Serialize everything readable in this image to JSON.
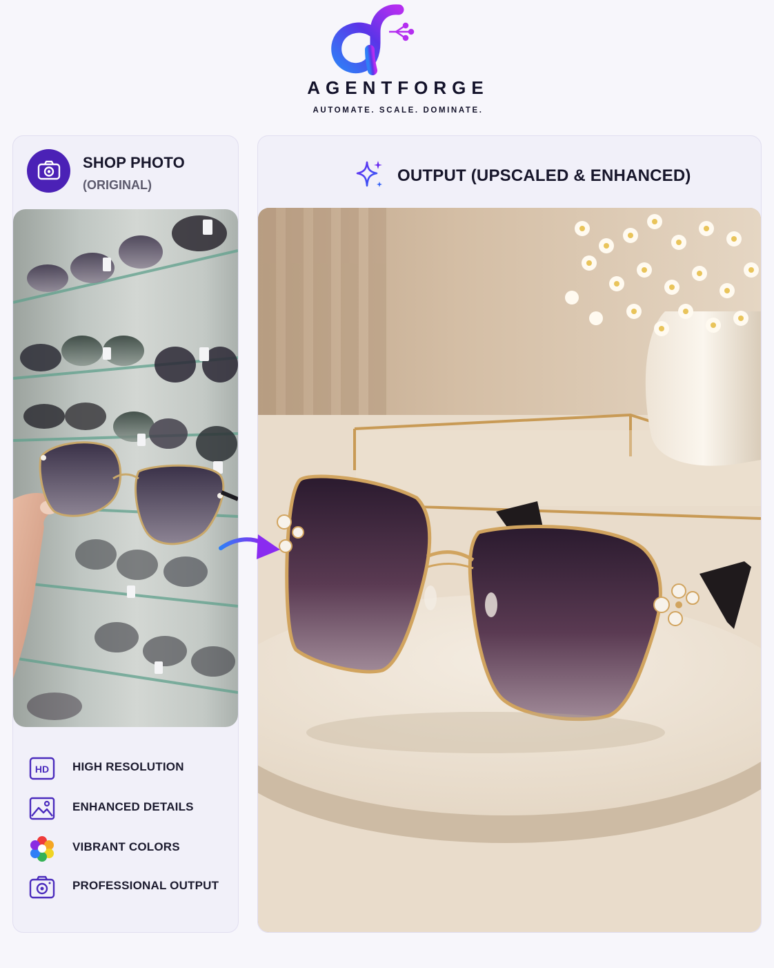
{
  "brand": {
    "name": "AGENTFORGE",
    "tagline": "AUTOMATE. SCALE. DOMINATE.",
    "logo_icon": "df-logo-mark",
    "accent_colors": [
      "#7a2bf0",
      "#2f7ff6",
      "#5b34e8"
    ]
  },
  "left_panel": {
    "title": "SHOP PHOTO",
    "subtitle": "(ORIGINAL)",
    "badge_icon": "camera-icon",
    "image_alt": "Hand holding sunglasses in front of shop display shelves"
  },
  "right_panel": {
    "title": "OUTPUT (UPSCALED & ENHANCED)",
    "title_icon": "sparkle-icon",
    "image_alt": "Sunglasses on marble stand with flowers background"
  },
  "features": [
    {
      "icon": "hd-icon",
      "label": "HIGH RESOLUTION",
      "badge": "HD"
    },
    {
      "icon": "image-icon",
      "label": "ENHANCED DETAILS"
    },
    {
      "icon": "color-wheel-icon",
      "label": "VIBRANT COLORS"
    },
    {
      "icon": "camera-icon",
      "label": "PROFESSIONAL OUTPUT"
    }
  ]
}
